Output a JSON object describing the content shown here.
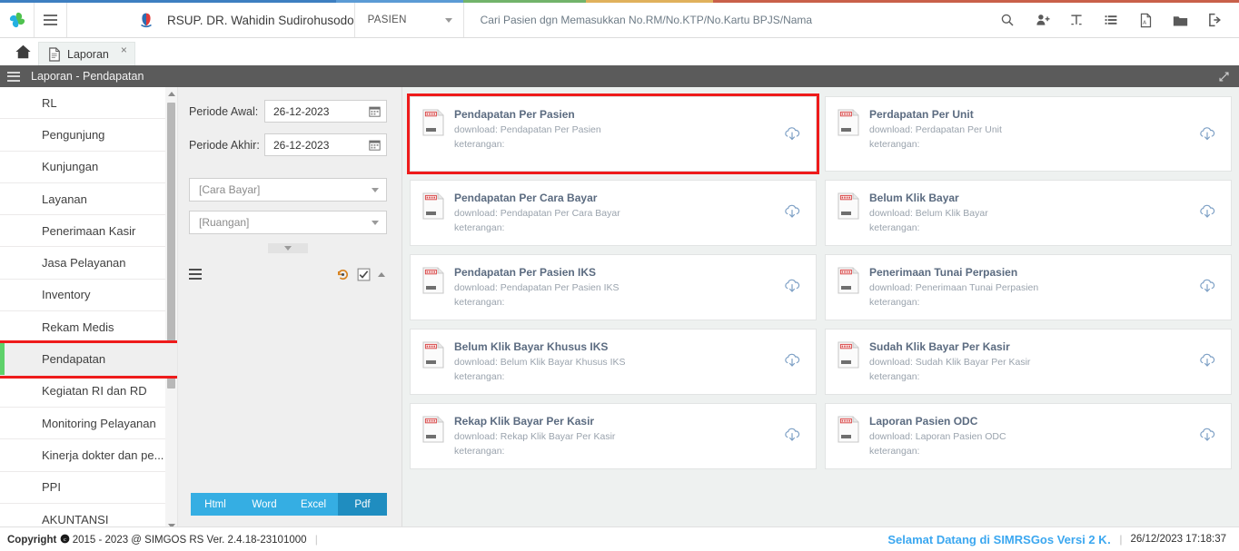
{
  "topbar": {
    "logo_icon": "simgos-pinwheel-logo",
    "menu_icon": "hamburger-icon",
    "hospital_icon": "hospital-crest-icon",
    "hospital_name": "RSUP. DR. Wahidin Sudirohusodo",
    "mode_select": {
      "value": "PASIEN",
      "caret_icon": "chevron-down-icon"
    },
    "search": {
      "placeholder": "Cari Pasien dgn Memasukkan No.RM/No.KTP/No.Kartu BPJS/Nama",
      "value": ""
    },
    "icons": [
      {
        "name": "search-icon",
        "glyph": "⌕"
      },
      {
        "name": "add-user-icon",
        "glyph": ""
      },
      {
        "name": "text-tool-icon",
        "glyph": ""
      },
      {
        "name": "list-icon",
        "glyph": ""
      },
      {
        "name": "pdf-file-icon",
        "glyph": ""
      },
      {
        "name": "folder-icon",
        "glyph": ""
      },
      {
        "name": "logout-icon",
        "glyph": ""
      }
    ]
  },
  "tabbar": {
    "home_icon": "home-icon",
    "tabs": [
      {
        "label": "Laporan",
        "icon": "document-icon",
        "close": "×",
        "active": true
      }
    ]
  },
  "page_header": {
    "title": "Laporan - Pendapatan",
    "menu_icon": "hamburger-icon",
    "expand_icon": "expand-arrows-icon"
  },
  "sidebar": {
    "items": [
      {
        "label": "RL",
        "active": false
      },
      {
        "label": "Pengunjung",
        "active": false
      },
      {
        "label": "Kunjungan",
        "active": false
      },
      {
        "label": "Layanan",
        "active": false
      },
      {
        "label": "Penerimaan Kasir",
        "active": false
      },
      {
        "label": "Jasa Pelayanan",
        "active": false
      },
      {
        "label": "Inventory",
        "active": false
      },
      {
        "label": "Rekam Medis",
        "active": false
      },
      {
        "label": "Pendapatan",
        "active": true
      },
      {
        "label": "Kegiatan RI dan RD",
        "active": false
      },
      {
        "label": "Monitoring Pelayanan",
        "active": false
      },
      {
        "label": "Kinerja dokter dan pe...",
        "active": false
      },
      {
        "label": "PPI",
        "active": false
      },
      {
        "label": "AKUNTANSI",
        "active": false
      }
    ],
    "scrollbar": {
      "up_icon": "triangle-up-icon",
      "down_icon": "triangle-down-icon"
    }
  },
  "filter": {
    "periode_awal": {
      "label": "Periode Awal:",
      "value": "26-12-2023",
      "icon": "calendar-icon"
    },
    "periode_akhir": {
      "label": "Periode Akhir:",
      "value": "26-12-2023",
      "icon": "calendar-icon"
    },
    "cara_bayar": {
      "value": "[Cara Bayar]",
      "caret_icon": "chevron-down-icon"
    },
    "ruangan": {
      "value": "[Ruangan]",
      "caret_icon": "chevron-down-icon"
    },
    "expander_icon": "chevron-down-icon",
    "toolbar": {
      "list_icon": "list-view-icon",
      "reset_icon": "history-reset-icon",
      "check_icon": "checkbox-checked-icon",
      "collapse_icon": "caret-up-icon"
    },
    "export_buttons": [
      {
        "label": "Html",
        "selected": false
      },
      {
        "label": "Word",
        "selected": false
      },
      {
        "label": "Excel",
        "selected": false
      },
      {
        "label": "Pdf",
        "selected": true
      }
    ]
  },
  "content": {
    "download_prefix": "download: ",
    "keterangan_label": "keterangan:",
    "card_icon": "report-document-icon",
    "download_icon": "cloud-download-icon",
    "cards": [
      {
        "title": "Pendapatan Per Pasien",
        "download": "download: Pendapatan Per Pasien",
        "keterangan": "keterangan:",
        "highlight": true
      },
      {
        "title": "Perdapatan Per Unit",
        "download": "download: Perdapatan Per Unit",
        "keterangan": "keterangan:",
        "highlight": false
      },
      {
        "title": "Pendapatan Per Cara Bayar",
        "download": "download: Pendapatan Per Cara Bayar",
        "keterangan": "keterangan:",
        "highlight": false
      },
      {
        "title": "Belum Klik Bayar",
        "download": "download: Belum Klik Bayar",
        "keterangan": "keterangan:",
        "highlight": false
      },
      {
        "title": "Pendapatan Per Pasien IKS",
        "download": "download: Pendapatan Per Pasien IKS",
        "keterangan": "keterangan:",
        "highlight": false
      },
      {
        "title": "Penerimaan Tunai Perpasien",
        "download": "download: Penerimaan Tunai Perpasien",
        "keterangan": "keterangan:",
        "highlight": false
      },
      {
        "title": "Belum Klik Bayar Khusus IKS",
        "download": "download: Belum Klik Bayar Khusus IKS",
        "keterangan": "keterangan:",
        "highlight": false
      },
      {
        "title": "Sudah Klik Bayar Per Kasir",
        "download": "download: Sudah Klik Bayar Per Kasir",
        "keterangan": "keterangan:",
        "highlight": false
      },
      {
        "title": "Rekap Klik Bayar Per Kasir",
        "download": "download: Rekap Klik Bayar Per Kasir",
        "keterangan": "keterangan:",
        "highlight": false
      },
      {
        "title": "Laporan Pasien ODC",
        "download": "download: Laporan Pasien ODC",
        "keterangan": "keterangan:",
        "highlight": false
      }
    ]
  },
  "footer": {
    "copyright_prefix": "Copyright",
    "copyright_icon": "copyright-icon",
    "copyright_text": "2015 - 2023 @ SIMGOS RS Ver. 2.4.18-23101000",
    "welcome": "Selamat Datang di SIMRSGos Versi 2 K…",
    "separator": "|",
    "timestamp": "26/12/2023 17:18:37"
  },
  "colors": {
    "accent_blue": "#35aee3",
    "accent_blue_dark": "#1f8dc0",
    "highlight_red": "#ee1b1b",
    "active_green": "#5ed16a",
    "header_dark": "#5b5b5b",
    "card_title": "#5b6b80"
  }
}
